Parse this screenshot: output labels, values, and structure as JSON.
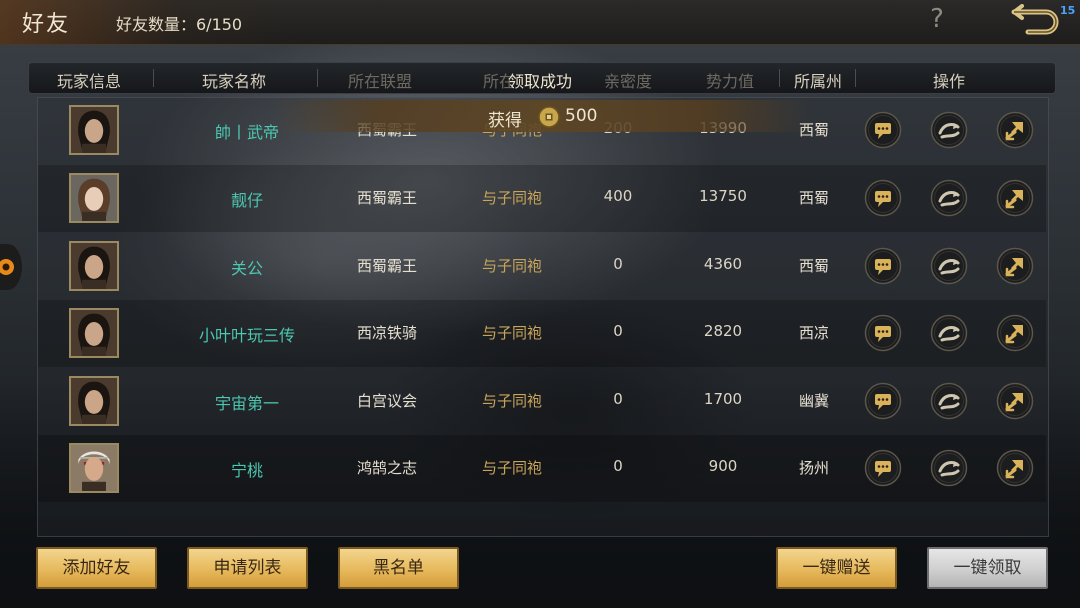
{
  "header": {
    "title": "好友",
    "friend_count_label": "好友数量：6/150",
    "help_icon": "?",
    "corner_badge": "15"
  },
  "columns": {
    "player_info": "玩家信息",
    "player_name": "玩家名称",
    "alliance": "所在联盟",
    "relation": "所在",
    "intimacy": "亲密度",
    "power": "势力值",
    "region": "所属州",
    "actions": "操作"
  },
  "toast": {
    "title": "领取成功",
    "gain_label": "获得",
    "amount": "500",
    "icon": "coin-icon"
  },
  "rows": [
    {
      "name": "帥丨武帝",
      "alliance": "西蜀霸王",
      "relation": "与子同袍",
      "intimacy": "200",
      "power": "13990",
      "region": "西蜀"
    },
    {
      "name": "靓仔",
      "alliance": "西蜀霸王",
      "relation": "与子同袍",
      "intimacy": "400",
      "power": "13750",
      "region": "西蜀"
    },
    {
      "name": "关公",
      "alliance": "西蜀霸王",
      "relation": "与子同袍",
      "intimacy": "0",
      "power": "4360",
      "region": "西蜀"
    },
    {
      "name": "小叶叶玩三传",
      "alliance": "西凉铁骑",
      "relation": "与子同袍",
      "intimacy": "0",
      "power": "2820",
      "region": "西凉"
    },
    {
      "name": "宇宙第一",
      "alliance": "白宫议会",
      "relation": "与子同袍",
      "intimacy": "0",
      "power": "1700",
      "region": "幽冀"
    },
    {
      "name": "宁桃",
      "alliance": "鸿鹄之志",
      "relation": "与子同袍",
      "intimacy": "0",
      "power": "900",
      "region": "扬州"
    }
  ],
  "buttons": {
    "add_friend": "添加好友",
    "apply_list": "申请列表",
    "blacklist": "黑名单",
    "gift_all": "一键赠送",
    "claim_all": "一键领取"
  },
  "colors": {
    "name_teal": "#4cc7b0",
    "relation_gold": "#c9a55a",
    "button_gold": "#e6b95c",
    "button_disabled": "#cfcfcf"
  }
}
